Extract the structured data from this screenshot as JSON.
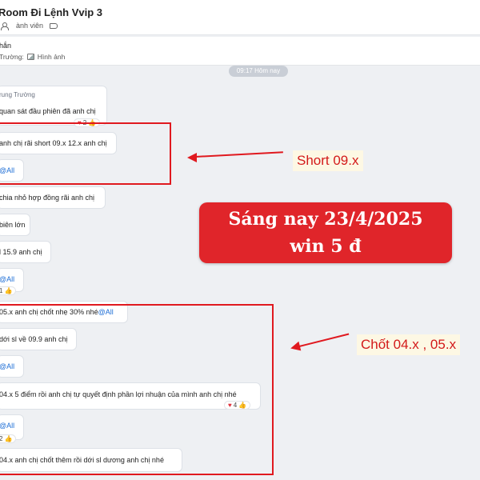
{
  "header": {
    "title": "Room Đi Lệnh Vvip 3",
    "members_label": "ành viên"
  },
  "pinned": {
    "title": "hắn",
    "sender_and_type": "Trường:",
    "attachment_label": "Hình ảnh"
  },
  "time_divider": "09:17 Hôm nay",
  "messages": [
    {
      "sender": "rung Trường",
      "text": "quan sát đầu phiên đã anh chị",
      "reaction": "2"
    },
    {
      "text": "anh chị rãi short 09.x 12.x anh chị"
    },
    {
      "text": "@All"
    },
    {
      "text": "chia nhỏ hợp đồng rãi anh chị"
    },
    {
      "text": "biên lớn"
    },
    {
      "text": "l 15.9 anh chị"
    },
    {
      "text": "@All",
      "reaction": "1"
    },
    {
      "text": "05.x anh chị chốt nhẹ 30% nhé ",
      "mention": "@All"
    },
    {
      "text": "dới sl về 09.9 anh chị"
    },
    {
      "text": "@All"
    },
    {
      "text": "04.x  5 điểm rồi anh chị tự quyết định phần lợi nhuận của mình anh chị nhé",
      "reaction": "4"
    },
    {
      "text": "@All",
      "reaction": "2"
    },
    {
      "text": "04.x anh chị chốt thêm rồi dới sl dương anh chị nhé"
    }
  ],
  "annotations": {
    "short_label": "Short 09.x",
    "chot_label": "Chốt 04.x , 05.x",
    "win_line1": "Sáng nay 23/4/2025",
    "win_line2": "win 5 đ"
  },
  "colors": {
    "annotation_red": "#e0191f",
    "badge_red": "#e0252a",
    "label_bg": "#fdf8e4",
    "mention_blue": "#1f6fd6",
    "chat_bg": "#eef0f3"
  }
}
